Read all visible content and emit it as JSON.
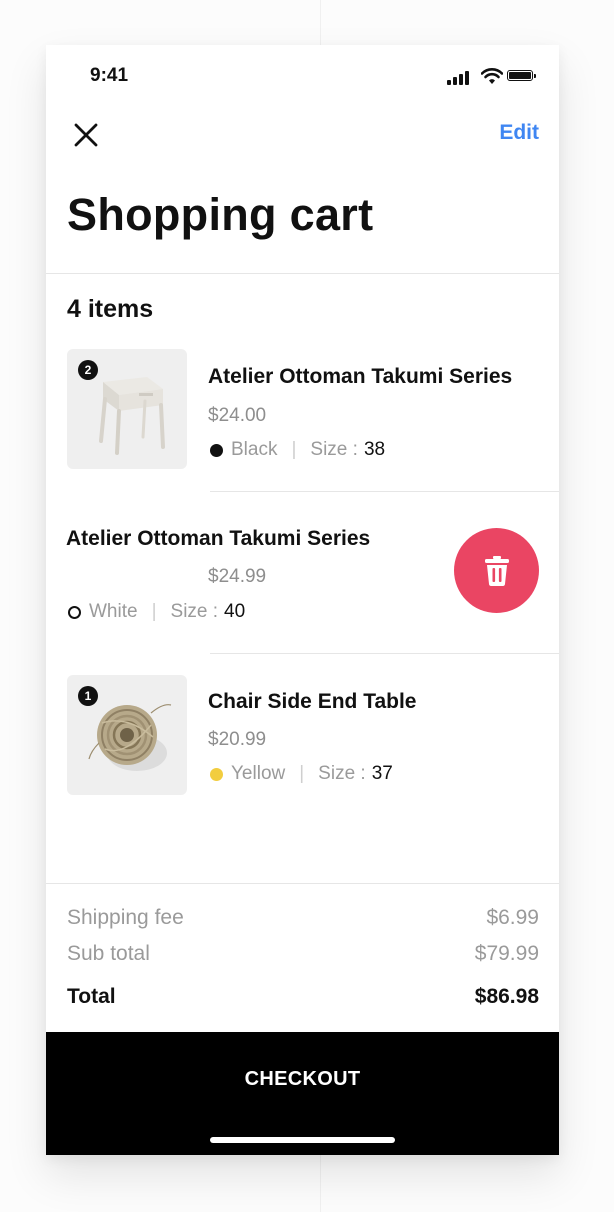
{
  "status_bar": {
    "time": "9:41",
    "icons": [
      "signal-icon",
      "wifi-icon",
      "battery-icon"
    ]
  },
  "header": {
    "close_icon": "close-icon",
    "edit_label": "Edit",
    "title": "Shopping cart"
  },
  "cart": {
    "count_label": "4 items",
    "items": [
      {
        "name": "Atelier Ottoman Takumi Series",
        "price": "$24.00",
        "color": "Black",
        "color_hex": "#111111",
        "size_label": "Size :",
        "size": "38",
        "quantity": "2",
        "image_icon": "side-table-image"
      },
      {
        "name": "Atelier Ottoman Takumi Series",
        "price": "$24.99",
        "color": "White",
        "color_hex": "#ffffff",
        "size_label": "Size :",
        "size": "40",
        "swiped": true
      },
      {
        "name": "Chair Side End Table",
        "price": "$20.99",
        "color": "Yellow",
        "color_hex": "#f2cd3f",
        "size_label": "Size :",
        "size": "37",
        "quantity": "1",
        "image_icon": "twine-ball-image"
      }
    ],
    "delete_icon": "trash-icon"
  },
  "summary": {
    "shipping_label": "Shipping fee",
    "shipping_value": "$6.99",
    "subtotal_label": "Sub total",
    "subtotal_value": "$79.99",
    "total_label": "Total",
    "total_value": "$86.98"
  },
  "checkout": {
    "label": "CHECKOUT"
  },
  "colors": {
    "accent": "#3f86f2",
    "delete": "#ea4563",
    "checkout_bg": "#000000"
  }
}
